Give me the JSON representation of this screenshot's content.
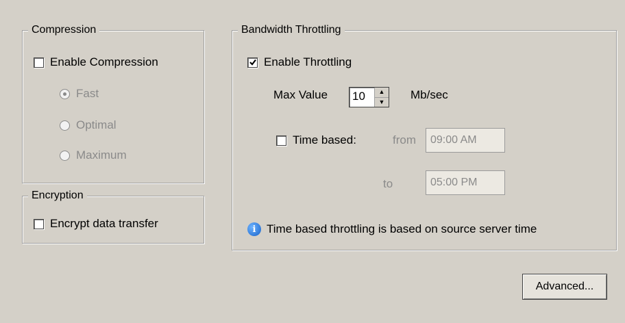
{
  "compression": {
    "title": "Compression",
    "enable_label": "Enable Compression",
    "enabled": false,
    "options": [
      {
        "label": "Fast",
        "selected": true
      },
      {
        "label": "Optimal",
        "selected": false
      },
      {
        "label": "Maximum",
        "selected": false
      }
    ]
  },
  "encryption": {
    "title": "Encryption",
    "encrypt_label": "Encrypt data transfer",
    "enabled": false
  },
  "throttling": {
    "title": "Bandwidth Throttling",
    "enable_label": "Enable Throttling",
    "enabled": true,
    "max_label": "Max Value",
    "max_value": "10",
    "unit": "Mb/sec",
    "time_based_label": "Time based:",
    "time_based_enabled": false,
    "from_label": "from",
    "from_value": "09:00 AM",
    "to_label": "to",
    "to_value": "05:00 PM",
    "info_text": "Time based throttling is based on source server time",
    "info_icon": "info-icon"
  },
  "advanced_label": "Advanced..."
}
